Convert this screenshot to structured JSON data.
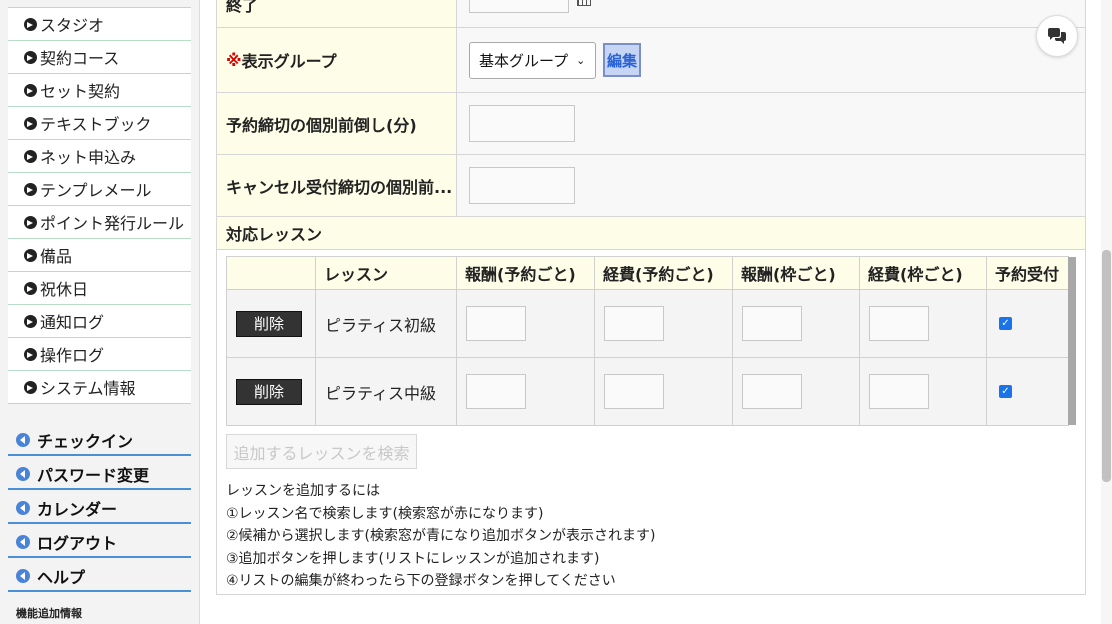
{
  "sidebar": {
    "menu": [
      {
        "label": "スタジオ"
      },
      {
        "label": "契約コース"
      },
      {
        "label": "セット契約"
      },
      {
        "label": "テキストブック"
      },
      {
        "label": "ネット申込み"
      },
      {
        "label": "テンプレメール"
      },
      {
        "label": "ポイント発行ルール"
      },
      {
        "label": "備品"
      },
      {
        "label": "祝休日"
      },
      {
        "label": "通知ログ"
      },
      {
        "label": "操作ログ"
      },
      {
        "label": "システム情報"
      }
    ],
    "nav": [
      {
        "label": "チェックイン"
      },
      {
        "label": "パスワード変更"
      },
      {
        "label": "カレンダー"
      },
      {
        "label": "ログアウト"
      },
      {
        "label": "ヘルプ"
      }
    ],
    "footer": "機能追加情報"
  },
  "form": {
    "end": {
      "label": "終了"
    },
    "group": {
      "required_mark": "※",
      "label": "表示グループ",
      "selected": "基本グループ",
      "edit_label": "編集"
    },
    "deadline": {
      "label": "予約締切の個別前倒し(分)",
      "value": ""
    },
    "cancel_deadline": {
      "label": "キャンセル受付締切の個別前...",
      "value": ""
    },
    "lessons": {
      "title": "対応レッスン",
      "columns": [
        "",
        "レッスン",
        "報酬(予約ごと)",
        "経費(予約ごと)",
        "報酬(枠ごと)",
        "経費(枠ごと)",
        "予約受付"
      ],
      "rows": [
        {
          "delete_label": "削除",
          "name": "ピラティス初級",
          "accepting": true
        },
        {
          "delete_label": "削除",
          "name": "ピラティス中級",
          "accepting": true
        }
      ],
      "search_button": "追加するレッスンを検索",
      "help": [
        "レッスンを追加するには",
        "①レッスン名で検索します(検索窓が赤になります)",
        "②候補から選択します(検索窓が青になり追加ボタンが表示されます)",
        "③追加ボタンを押します(リストにレッスンが追加されます)",
        "④リストの編集が終わったら下の登録ボタンを押してください"
      ]
    }
  },
  "icons": {
    "menu": "circle-arrow-right-icon",
    "nav": "circle-arrow-left-icon",
    "chat": "chat-bubbles-icon",
    "calendar": "calendar-icon"
  },
  "colors": {
    "required": "#e00000",
    "label_bg": "#fdfde8",
    "nav_underline": "#4a90d9",
    "edit_button_bg": "#c5d5f3"
  }
}
